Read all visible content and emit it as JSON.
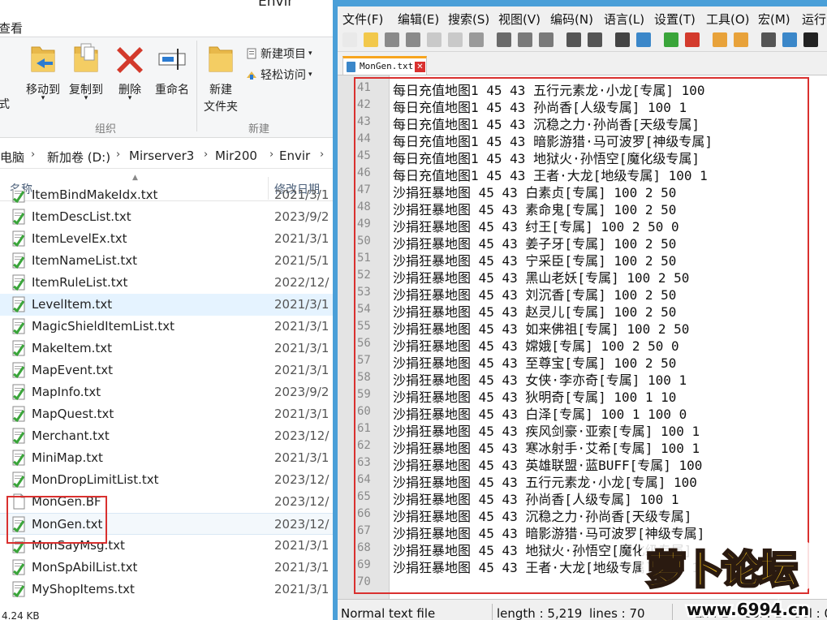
{
  "explorer": {
    "title": "Envir",
    "view_tab": "查看",
    "ribbon": {
      "move_to": "移动到",
      "copy_to": "复制到",
      "delete": "删除",
      "rename": "重命名",
      "organize_group": "组织",
      "new_folder": "新建",
      "new_folder_2": "文件夹",
      "new_item": "新建项目",
      "easy_access": "轻松访问",
      "new_group": "新建",
      "left_fragment": "式"
    },
    "address": [
      "电脑",
      "新加卷 (D:)",
      "Mirserver3",
      "Mir200",
      "Envir"
    ],
    "columns": {
      "name": "名称",
      "date": "修改日期"
    },
    "files": [
      {
        "name": "ItemBindMakeIdx.txt",
        "date": "2021/3/1"
      },
      {
        "name": "ItemDescList.txt",
        "date": "2023/9/2"
      },
      {
        "name": "ItemLevelEx.txt",
        "date": "2021/3/1"
      },
      {
        "name": "ItemNameList.txt",
        "date": "2021/5/1"
      },
      {
        "name": "ItemRuleList.txt",
        "date": "2022/12/"
      },
      {
        "name": "LevelItem.txt",
        "date": "2021/3/1"
      },
      {
        "name": "MagicShieldItemList.txt",
        "date": "2021/3/1"
      },
      {
        "name": "MakeItem.txt",
        "date": "2021/3/1"
      },
      {
        "name": "MapEvent.txt",
        "date": "2021/3/1"
      },
      {
        "name": "MapInfo.txt",
        "date": "2023/9/2"
      },
      {
        "name": "MapQuest.txt",
        "date": "2021/3/1"
      },
      {
        "name": "Merchant.txt",
        "date": "2023/12/"
      },
      {
        "name": "MiniMap.txt",
        "date": "2021/3/1"
      },
      {
        "name": "MonDropLimitList.txt",
        "date": "2023/12/"
      },
      {
        "name": "MonGen.BF",
        "date": "2023/12/"
      },
      {
        "name": "MonGen.txt",
        "date": "2023/12/"
      },
      {
        "name": "MonSayMsg.txt",
        "date": "2021/3/1"
      },
      {
        "name": "MonSpAbilList.txt",
        "date": "2021/3/1"
      },
      {
        "name": "MyShopItems.txt",
        "date": "2021/3/1"
      }
    ],
    "status": "4.24 KB"
  },
  "npp": {
    "menu": [
      "文件(F)",
      "编辑(E)",
      "搜索(S)",
      "视图(V)",
      "编码(N)",
      "语言(L)",
      "设置(T)",
      "工具(O)",
      "宏(M)",
      "运行("
    ],
    "tab_label": "MonGen.txt",
    "tab_close": "✕",
    "lines": [
      {
        "n": "41",
        "t": "每日充值地图1    45   43   五行元素龙·小龙[专属]    100"
      },
      {
        "n": "42",
        "t": "每日充值地图1    45   43   孙尚香[人级专属]     100  1"
      },
      {
        "n": "43",
        "t": "每日充值地图1    45   43   沉稳之力·孙尚香[天级专属]"
      },
      {
        "n": "44",
        "t": "每日充值地图1    45   43   暗影游猎·马可波罗[神级专属]"
      },
      {
        "n": "45",
        "t": "每日充值地图1    45   43   地狱火·孙悟空[魔化级专属]"
      },
      {
        "n": "46",
        "t": "每日充值地图1    45   43   王者·大龙[地级专属]  100  1"
      },
      {
        "n": "47",
        "t": "沙捐狂暴地图     45   43   白素贞[专属]     100  2   50"
      },
      {
        "n": "48",
        "t": "沙捐狂暴地图     45   43   素命鬼[专属]     100  2   50"
      },
      {
        "n": "49",
        "t": "沙捐狂暴地图     45   43   纣王[专属]   100  2   50   0"
      },
      {
        "n": "50",
        "t": "沙捐狂暴地图     45   43   姜子牙[专属]     100  2   50"
      },
      {
        "n": "51",
        "t": "沙捐狂暴地图     45   43   宁采臣[专属]     100  2   50"
      },
      {
        "n": "52",
        "t": "沙捐狂暴地图     45   43   黑山老妖[专属]   100  2   50"
      },
      {
        "n": "53",
        "t": "沙捐狂暴地图     45   43   刘沉香[专属]     100  2   50"
      },
      {
        "n": "54",
        "t": "沙捐狂暴地图     45   43   赵灵儿[专属]     100  2   50"
      },
      {
        "n": "55",
        "t": "沙捐狂暴地图     45   43   如来佛祖[专属]   100  2   50"
      },
      {
        "n": "56",
        "t": "沙捐狂暴地图     45   43   嫦娥[专属]   100  2   50   0"
      },
      {
        "n": "57",
        "t": "沙捐狂暴地图     45   43   至尊宝[专属]     100  2   50"
      },
      {
        "n": "58",
        "t": "沙捐狂暴地图     45   43   女侠·李亦奇[专属]    100  1"
      },
      {
        "n": "59",
        "t": "沙捐狂暴地图     45   43   狄明奇[专属]     100  1   10"
      },
      {
        "n": "60",
        "t": "沙捐狂暴地图     45   43   白泽[专属]   100  1   100  0"
      },
      {
        "n": "61",
        "t": "沙捐狂暴地图     45   43   疾风剑豪·亚索[专属]  100  1"
      },
      {
        "n": "62",
        "t": "沙捐狂暴地图     45   43   寒冰射手·艾希[专属]  100  1"
      },
      {
        "n": "63",
        "t": "沙捐狂暴地图     45   43   英雄联盟·蓝BUFF[专属]    100"
      },
      {
        "n": "64",
        "t": "沙捐狂暴地图     45   43   五行元素龙·小龙[专属]    100"
      },
      {
        "n": "65",
        "t": "沙捐狂暴地图     45   43   孙尚香[人级专属]     100  1"
      },
      {
        "n": "66",
        "t": "沙捐狂暴地图     45   43   沉稳之力·孙尚香[天级专属]"
      },
      {
        "n": "67",
        "t": "沙捐狂暴地图     45   43   暗影游猎·马可波罗[神级专属]"
      },
      {
        "n": "68",
        "t": "沙捐狂暴地图     45   43   地狱火·孙悟空[魔化级专属]"
      },
      {
        "n": "69",
        "t": "沙捐狂暴地图     45   43   王者·大龙[地级专属]  100  1"
      },
      {
        "n": "70",
        "t": ""
      }
    ],
    "status": {
      "type": "Normal text file",
      "length": "length : 5,219",
      "lines": "lines : 70",
      "ln": "Ln : 1",
      "col": "Col : 1",
      "sel": "Sel : 0"
    }
  },
  "watermark": {
    "text": "萝卜论坛",
    "url": "www.6994.cn"
  },
  "colors": {
    "accent": "#4a9fd8",
    "highlight": "#d9302f",
    "tab_marker": "#f7a51e"
  }
}
